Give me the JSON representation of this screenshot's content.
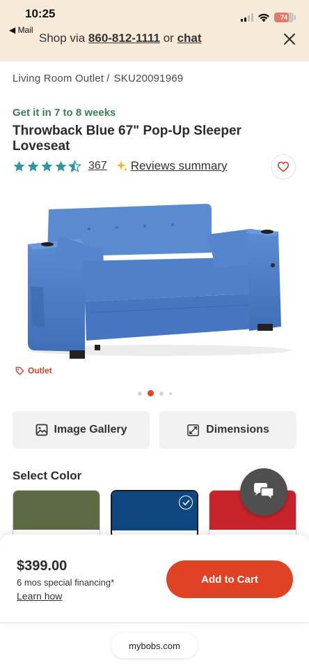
{
  "status_bar": {
    "time": "10:25",
    "back_label": "◀ Mail",
    "battery": "74"
  },
  "promo": {
    "prefix": "Shop via",
    "phone": "860-812-1111",
    "middle": "or",
    "chat_label": "chat"
  },
  "breadcrumb": {
    "category": "Living Room Outlet",
    "separator": "/",
    "sku": "SKU20091969"
  },
  "product": {
    "delivery": "Get it in 7 to 8 weeks",
    "title": "Throwback Blue 67\" Pop-Up Sleeper Loveseat",
    "rating": 4.5,
    "review_count": "367",
    "reviews_summary_label": "Reviews summary",
    "outlet_badge": "Outlet",
    "image_count": 4,
    "active_image_index": 1
  },
  "actions": {
    "gallery_label": "Image Gallery",
    "dimensions_label": "Dimensions"
  },
  "colors": {
    "heading": "Select Color",
    "swatches": [
      {
        "hex": "#5d6b45",
        "selected": false
      },
      {
        "hex": "#0f4680",
        "selected": true
      },
      {
        "hex": "#c8232a",
        "selected": false
      }
    ]
  },
  "purchase": {
    "price": "$399.00",
    "financing": "6 mos special financing*",
    "learn_how": "Learn how",
    "cta": "Add to Cart"
  },
  "browser": {
    "url": "mybobs.com"
  },
  "theme": {
    "accent": "#e04226",
    "banner_bg": "#f8ead8",
    "delivery_green": "#3f7d56",
    "star_color": "#2a96a0"
  }
}
